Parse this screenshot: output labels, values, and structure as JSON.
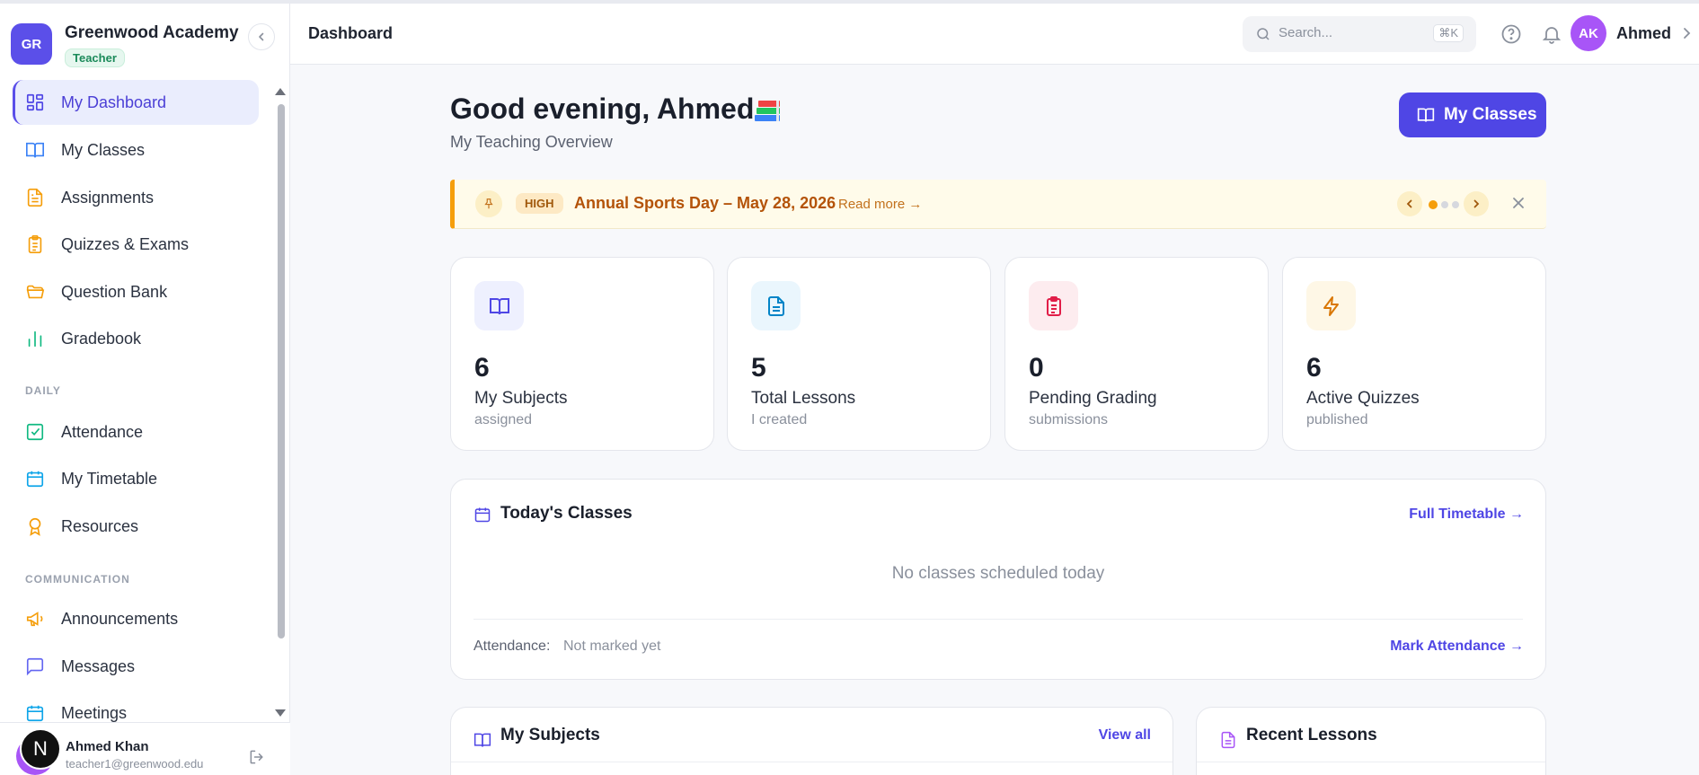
{
  "app": {
    "brand_initials": "GR",
    "brand_name": "Greenwood Academy",
    "role": "Teacher"
  },
  "sidebar": {
    "items": [
      {
        "label": "My Dashboard",
        "icon": "dashboard-grid-icon",
        "active": true
      },
      {
        "label": "My Classes",
        "icon": "book-open-icon"
      },
      {
        "label": "Assignments",
        "icon": "document-icon"
      },
      {
        "label": "Quizzes & Exams",
        "icon": "clipboard-icon"
      },
      {
        "label": "Question Bank",
        "icon": "folder-open-icon"
      },
      {
        "label": "Gradebook",
        "icon": "bar-chart-icon"
      }
    ],
    "section_daily": "DAILY",
    "daily_items": [
      {
        "label": "Attendance",
        "icon": "check-square-icon"
      },
      {
        "label": "My Timetable",
        "icon": "calendar-icon"
      },
      {
        "label": "Resources",
        "icon": "award-icon"
      }
    ],
    "section_communication": "COMMUNICATION",
    "communication_items": [
      {
        "label": "Announcements",
        "icon": "megaphone-icon"
      },
      {
        "label": "Messages",
        "icon": "message-square-icon"
      },
      {
        "label": "Meetings",
        "icon": "calendar-icon"
      }
    ]
  },
  "user": {
    "initial": "N",
    "name": "Ahmed Khan",
    "email": "teacher1@greenwood.edu"
  },
  "header": {
    "title": "Dashboard",
    "search_placeholder": "Search...",
    "search_shortcut": "⌘K",
    "avatar_initials": "AK",
    "user_first_name": "Ahmed"
  },
  "main": {
    "greeting": "Good evening, Ahmed",
    "subtitle": "My Teaching Overview",
    "primary_button": "My Classes"
  },
  "banner": {
    "priority": "HIGH",
    "title": "Annual Sports Day – May 28, 2026",
    "read_more": "Read more →",
    "slides": 3,
    "current_slide": 1
  },
  "stats": [
    {
      "value": "6",
      "label": "My Subjects",
      "sub": "assigned",
      "icon": "book-open-icon",
      "color": "#4f46e5",
      "bg": "#eef0fe"
    },
    {
      "value": "5",
      "label": "Total Lessons",
      "sub": "I created",
      "icon": "document-icon",
      "color": "#0284c7",
      "bg": "#eaf6fd"
    },
    {
      "value": "0",
      "label": "Pending Grading",
      "sub": "submissions",
      "icon": "clipboard-icon",
      "color": "#e11d48",
      "bg": "#fdecef"
    },
    {
      "value": "6",
      "label": "Active Quizzes",
      "sub": "published",
      "icon": "lightning-icon",
      "color": "#d97706",
      "bg": "#fef7e6"
    }
  ],
  "todays_classes": {
    "title": "Today's Classes",
    "link": "Full Timetable →",
    "empty": "No classes scheduled today",
    "attendance_label": "Attendance:",
    "attendance_value": "Not marked yet",
    "mark_link": "Mark Attendance →"
  },
  "my_subjects": {
    "title": "My Subjects",
    "link": "View all"
  },
  "recent_lessons": {
    "title": "Recent Lessons"
  },
  "colors": {
    "accent": "#4f46e5",
    "brand": "#5b4fe9",
    "warning": "#f59e0b"
  }
}
